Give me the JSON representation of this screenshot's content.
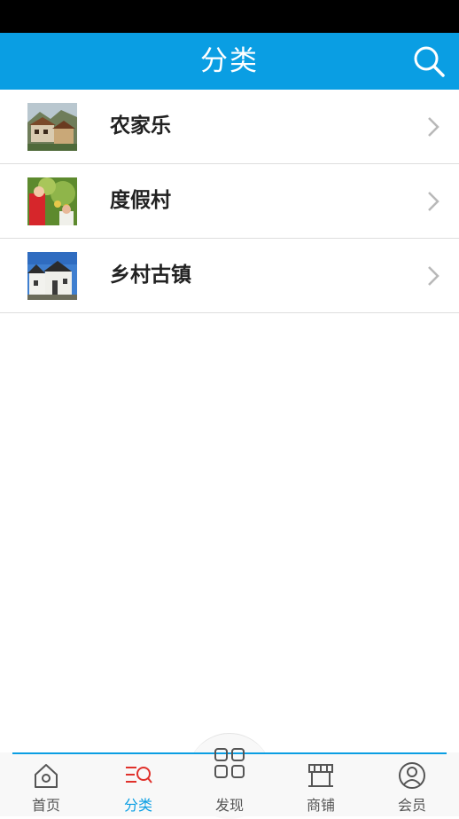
{
  "header": {
    "title": "分类",
    "search_icon": "search-icon"
  },
  "categories": [
    {
      "label": "农家乐",
      "thumb": "farmhouse-thumbnail"
    },
    {
      "label": "度假村",
      "thumb": "resort-thumbnail"
    },
    {
      "label": "乡村古镇",
      "thumb": "ancient-town-thumbnail"
    }
  ],
  "tabbar": {
    "tabs": [
      {
        "label": "首页",
        "icon": "home-icon",
        "active": false
      },
      {
        "label": "分类",
        "icon": "category-search-icon",
        "active": true
      },
      {
        "label": "发现",
        "icon": "grid-icon",
        "active": false
      },
      {
        "label": "商铺",
        "icon": "store-icon",
        "active": false
      },
      {
        "label": "会员",
        "icon": "user-icon",
        "active": false
      }
    ]
  },
  "colors": {
    "accent": "#0a9ee3",
    "active_icon": "#e0312b",
    "status_bar": "#000000"
  }
}
